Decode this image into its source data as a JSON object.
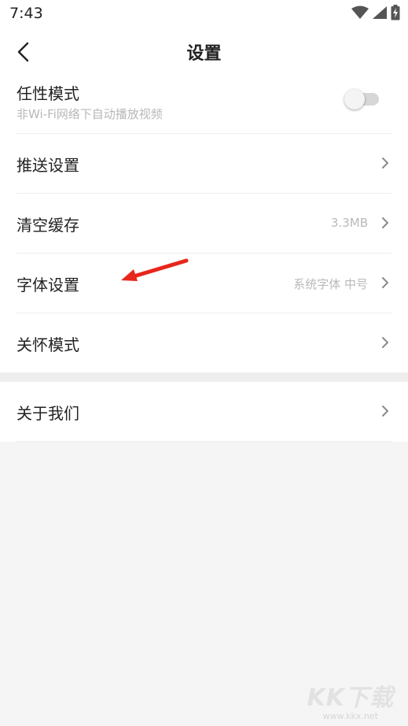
{
  "status_bar": {
    "time": "7:43"
  },
  "header": {
    "title": "设置"
  },
  "settings": {
    "wilful_mode": {
      "label": "任性模式",
      "sublabel": "非Wi-Fi网络下自动播放视频",
      "enabled": false
    },
    "push": {
      "label": "推送设置"
    },
    "cache": {
      "label": "清空缓存",
      "value": "3.3MB"
    },
    "font": {
      "label": "字体设置",
      "value": "系统字体 中号"
    },
    "care_mode": {
      "label": "关怀模式"
    },
    "about": {
      "label": "关于我们"
    }
  },
  "icons": [
    "back-arrow-icon",
    "wifi-icon",
    "signal-icon",
    "battery-charging-icon",
    "chevron-right-icon",
    "red-arrow-annotation"
  ],
  "colors": {
    "annotation_arrow": "#e8261c",
    "toggle_off_track": "#d7d7d7",
    "secondary_text": "#b9b9b9"
  },
  "watermark": {
    "logo": "KK下载",
    "url": "www.kkx.net"
  }
}
